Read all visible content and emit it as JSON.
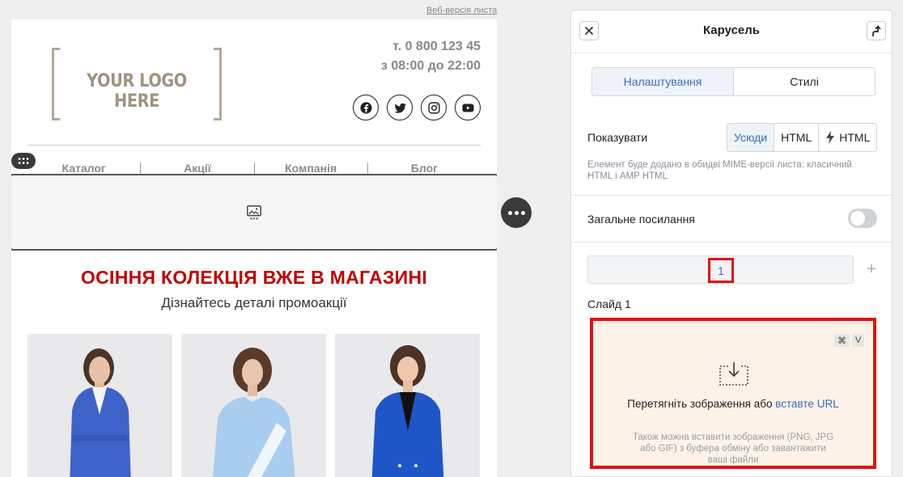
{
  "email": {
    "web_version_link": "Веб-версія листа",
    "logo_text": "YOUR LOGO HERE",
    "phone": "т. 0 800 123 45",
    "hours": "з 08:00 до 22:00",
    "socials": [
      "facebook-icon",
      "twitter-icon",
      "instagram-icon",
      "youtube-icon"
    ],
    "nav": [
      "Каталог",
      "Акції",
      "Компанія",
      "Блог"
    ],
    "promo_title": "ОСІННЯ КОЛЕКЦІЯ ВЖЕ В МАГАЗИНІ",
    "promo_subtitle": "Дізнайтесь деталі промоакції",
    "products": [
      {
        "coat_color": "#3e63c8"
      },
      {
        "coat_color": "#a9cdef"
      },
      {
        "coat_color": "#1f56c7"
      }
    ]
  },
  "panel": {
    "title": "Карусель",
    "tabs": [
      "Налаштування",
      "Стилі"
    ],
    "show_label": "Показувати",
    "show_options": [
      "Усюди",
      "HTML",
      "HTML"
    ],
    "show_hint": "Елемент буде додано в обидві MIME-версії листа: класичний HTML і AMP HTML",
    "common_link_label": "Загальне посилання",
    "slide_tab": "1",
    "add_slide": "+",
    "slide_label": "Слайд 1",
    "drop": {
      "shortcut_cmd": "⌘",
      "shortcut_key": "V",
      "text": "Перетягніть зображення або",
      "link": "вставте URL",
      "hint": "Також можна вставити зображення (PNG, JPG або GIF) з буфера обміну або завантажити ваші файли"
    }
  },
  "colors": {
    "accent": "#3a6cc0",
    "promo_red": "#c00000",
    "highlight_red": "#e01010",
    "drop_bg": "#fdf2e8"
  }
}
